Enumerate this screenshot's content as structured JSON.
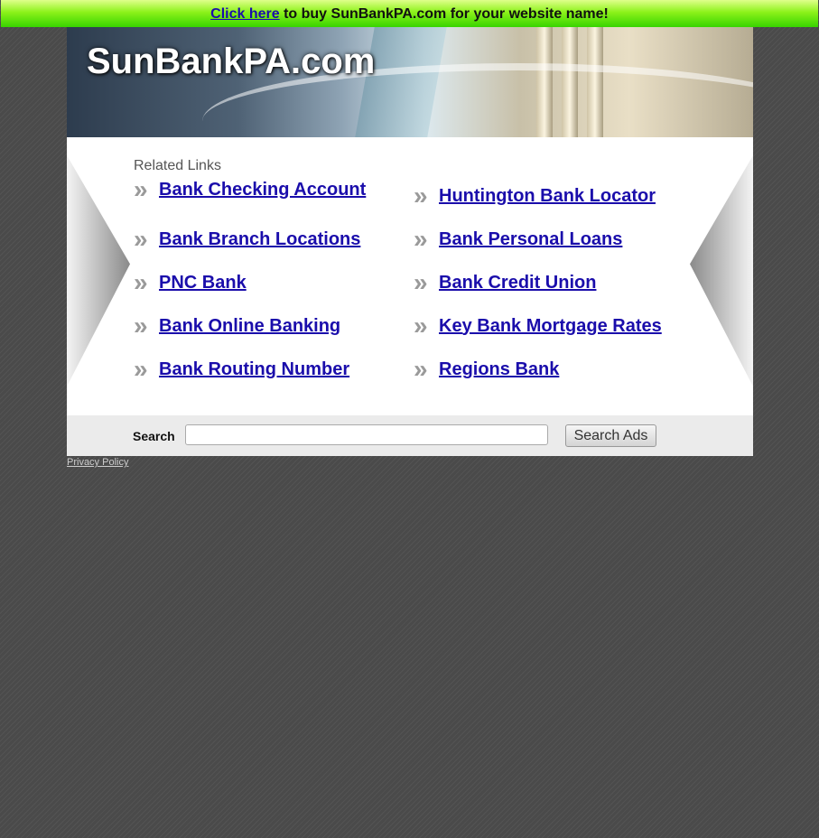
{
  "topbar": {
    "link_text": "Click here",
    "rest_text": " to buy SunBankPA.com for your website name!"
  },
  "header": {
    "site_title": "SunBankPA.com"
  },
  "links": {
    "section_label": "Related Links",
    "arrow": "»",
    "left": [
      "Bank Checking Account",
      "Bank Branch Locations",
      "PNC Bank",
      "Bank Online Banking",
      "Bank Routing Number"
    ],
    "right": [
      "Huntington Bank Locator",
      "Bank Personal Loans",
      "Bank Credit Union",
      "Key Bank Mortgage Rates",
      "Regions Bank"
    ]
  },
  "search": {
    "label": "Search",
    "input_value": "",
    "button_label": "Search Ads"
  },
  "footer": {
    "privacy_label": "Privacy Policy"
  },
  "colors": {
    "link": "#1a0dab",
    "topbar_green": "#38d400",
    "page_background": "#4a4a4a"
  }
}
